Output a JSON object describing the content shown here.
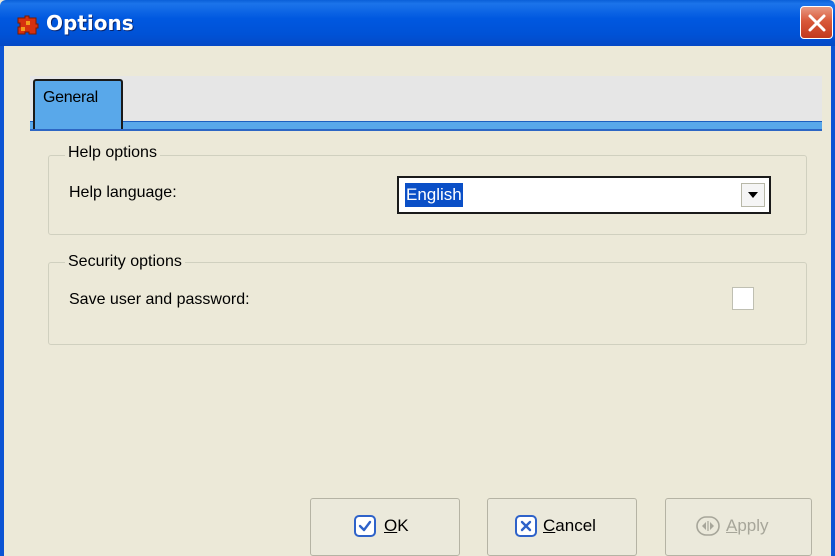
{
  "window": {
    "title": "Options",
    "title_color": "#0055e5",
    "close_icon": "close-icon",
    "app_icon": "puzzle-icon"
  },
  "tabs": [
    {
      "label": "General",
      "selected": true
    }
  ],
  "help_options": {
    "group_title": "Help options",
    "language_label": "Help language:",
    "language_value": "English"
  },
  "security_options": {
    "group_title": "Security options",
    "save_label": "Save user and password:",
    "save_checked": false
  },
  "buttons": {
    "ok": {
      "mnemonic": "O",
      "rest": "K",
      "enabled": true,
      "icon": "check-icon"
    },
    "cancel": {
      "mnemonic": "C",
      "rest": "ancel",
      "enabled": true,
      "icon": "x-icon"
    },
    "apply": {
      "mnemonic": "A",
      "rest": "pply",
      "enabled": false,
      "icon": "apply-icon"
    }
  },
  "colors": {
    "face": "#ece9d8",
    "selection": "#0a4fc7",
    "tab_accent": "#59a8ea",
    "disabled_text": "#a7a69a"
  }
}
